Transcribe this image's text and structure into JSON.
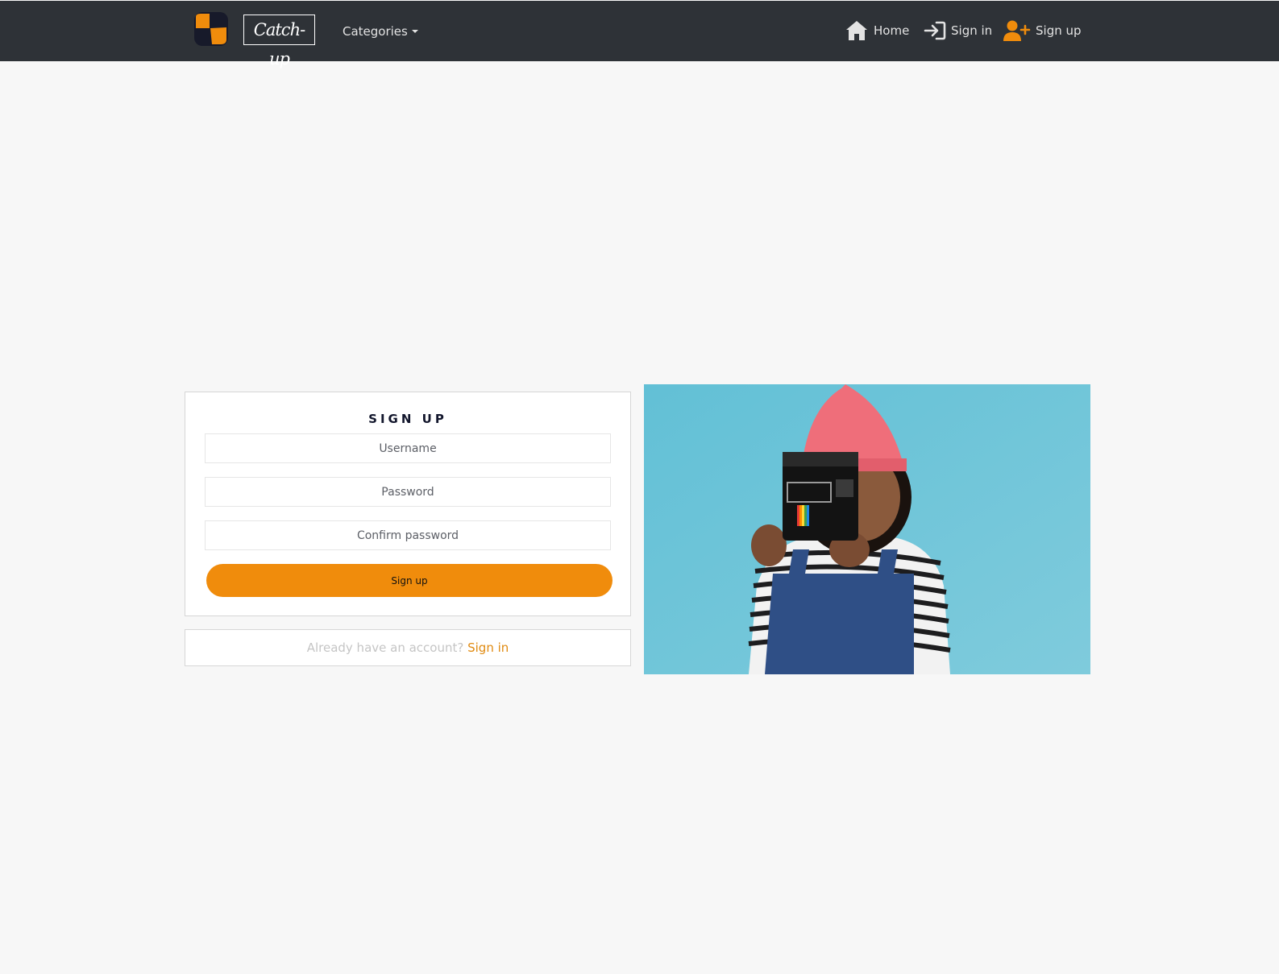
{
  "navbar": {
    "brand": "Catch-up",
    "categories_label": "Categories",
    "links": {
      "home": "Home",
      "sign_in": "Sign in",
      "sign_up": "Sign up"
    }
  },
  "signup_form": {
    "title": "SIGN UP",
    "username_placeholder": "Username",
    "username_value": "",
    "password_placeholder": "Password",
    "password_value": "",
    "confirm_placeholder": "Confirm password",
    "confirm_value": "",
    "submit_label": "Sign up"
  },
  "signin_prompt": {
    "text": "Already have an account?",
    "link": "Sign in"
  },
  "icons": {
    "logo": "app-logo-icon",
    "home": "home-icon",
    "sign_in": "sign-in-icon",
    "sign_up": "user-plus-icon"
  },
  "colors": {
    "navbar_bg": "#2e3237",
    "accent": "#f08c0c",
    "page_bg": "#f7f7f7",
    "photo_bg": "#6cc6d8"
  }
}
